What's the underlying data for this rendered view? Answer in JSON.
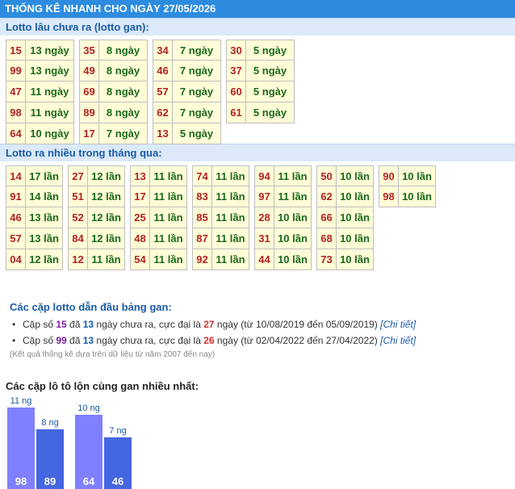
{
  "title": "THỐNG KÊ NHANH CHO NGÀY 27/05/2026",
  "section1": {
    "title": "Lotto lâu chưa ra (lotto gan):",
    "columns": [
      [
        [
          "15",
          "13 ngày"
        ],
        [
          "99",
          "13 ngày"
        ],
        [
          "47",
          "11 ngày"
        ],
        [
          "98",
          "11 ngày"
        ],
        [
          "64",
          "10 ngày"
        ]
      ],
      [
        [
          "35",
          "8 ngày"
        ],
        [
          "49",
          "8 ngày"
        ],
        [
          "69",
          "8 ngày"
        ],
        [
          "89",
          "8 ngày"
        ],
        [
          "17",
          "7 ngày"
        ]
      ],
      [
        [
          "34",
          "7 ngày"
        ],
        [
          "46",
          "7 ngày"
        ],
        [
          "57",
          "7 ngày"
        ],
        [
          "62",
          "7 ngày"
        ],
        [
          "13",
          "5 ngày"
        ]
      ],
      [
        [
          "30",
          "5 ngày"
        ],
        [
          "37",
          "5 ngày"
        ],
        [
          "60",
          "5 ngày"
        ],
        [
          "61",
          "5 ngày"
        ]
      ]
    ]
  },
  "section2": {
    "title": "Lotto ra nhiều trong tháng qua:",
    "columns": [
      [
        [
          "14",
          "17 lần"
        ],
        [
          "91",
          "14 lần"
        ],
        [
          "46",
          "13 lần"
        ],
        [
          "57",
          "13 lần"
        ],
        [
          "04",
          "12 lần"
        ]
      ],
      [
        [
          "27",
          "12 lần"
        ],
        [
          "51",
          "12 lần"
        ],
        [
          "52",
          "12 lần"
        ],
        [
          "84",
          "12 lần"
        ],
        [
          "12",
          "11 lần"
        ]
      ],
      [
        [
          "13",
          "11 lần"
        ],
        [
          "17",
          "11 lần"
        ],
        [
          "25",
          "11 lần"
        ],
        [
          "48",
          "11 lần"
        ],
        [
          "54",
          "11 lần"
        ]
      ],
      [
        [
          "74",
          "11 lần"
        ],
        [
          "83",
          "11 lần"
        ],
        [
          "85",
          "11 lần"
        ],
        [
          "87",
          "11 lần"
        ],
        [
          "92",
          "11 lần"
        ]
      ],
      [
        [
          "94",
          "11 lần"
        ],
        [
          "97",
          "11 lần"
        ],
        [
          "28",
          "10 lần"
        ],
        [
          "31",
          "10 lần"
        ],
        [
          "44",
          "10 lần"
        ]
      ],
      [
        [
          "50",
          "10 lần"
        ],
        [
          "62",
          "10 lần"
        ],
        [
          "66",
          "10 lần"
        ],
        [
          "68",
          "10 lần"
        ],
        [
          "73",
          "10 lần"
        ]
      ],
      [
        [
          "90",
          "10 lần"
        ],
        [
          "98",
          "10 lần"
        ]
      ]
    ]
  },
  "pairs": {
    "title": "Các cặp lotto dẫn đầu bảng gan:",
    "items": [
      {
        "a": "Cặp số ",
        "pair": "15",
        "b": " đã ",
        "days": "13",
        "c": " ngày chưa ra, cực đại là ",
        "max": "27",
        "d": " ngày (từ 10/08/2019 đến 05/09/2019) ",
        "link": "[Chi tiết]"
      },
      {
        "a": "Cặp số ",
        "pair": "99",
        "b": " đã ",
        "days": "13",
        "c": " ngày chưa ra, cực đại là ",
        "max": "26",
        "d": " ngày (từ 02/04/2022 đến 27/04/2022) ",
        "link": "[Chi tiết]"
      }
    ],
    "note": "(Kết quả thống kê dựa trên dữ liệu từ năm 2007 đến nay)"
  },
  "chart_title": "Các cặp lô tô lộn cùng gan nhiều nhất:",
  "chart_data": {
    "type": "bar",
    "categories": [
      "98",
      "89",
      "64",
      "46"
    ],
    "values": [
      11,
      8,
      10,
      7
    ],
    "value_labels": [
      "11 ng",
      "8 ng",
      "10 ng",
      "7 ng"
    ],
    "colors": [
      "#8080ff",
      "#4466e0",
      "#8080ff",
      "#4466e0"
    ]
  }
}
